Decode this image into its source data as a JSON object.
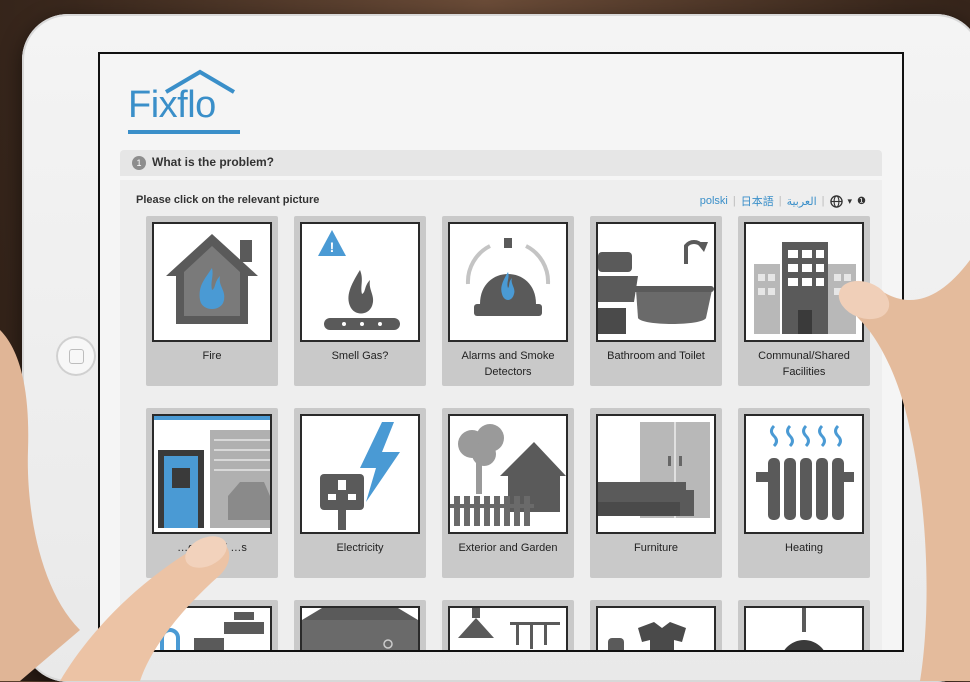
{
  "app": {
    "brand": "Fixflo"
  },
  "step": {
    "number": "1",
    "title": "What is the problem?"
  },
  "instruction": "Please click on the relevant picture",
  "languages": [
    "polski",
    "日本語",
    "العربية"
  ],
  "globe_menu": {
    "icon": "globe-icon",
    "caret": "▾",
    "info": "❶"
  },
  "tiles_row1": [
    {
      "label": "Fire",
      "icon": "house-fire-icon"
    },
    {
      "label": "Smell Gas?",
      "icon": "gas-flame-icon"
    },
    {
      "label": "Alarms and Smoke Detectors",
      "icon": "alarm-bell-icon"
    },
    {
      "label": "Bathroom and Toilet",
      "icon": "bathroom-icon"
    },
    {
      "label": "Communal/Shared Facilities",
      "icon": "building-icon"
    }
  ],
  "tiles_row2": [
    {
      "label": "…ges and …s",
      "icon": "door-garage-icon"
    },
    {
      "label": "Electricity",
      "icon": "electricity-icon"
    },
    {
      "label": "Exterior and Garden",
      "icon": "garden-icon"
    },
    {
      "label": "Furniture",
      "icon": "furniture-icon"
    },
    {
      "label": "Heating",
      "icon": "radiator-icon"
    }
  ],
  "colors": {
    "brand_blue": "#3a8fc9",
    "tile_bg": "#c9c9c9",
    "icon_grey": "#5a5a5a"
  }
}
